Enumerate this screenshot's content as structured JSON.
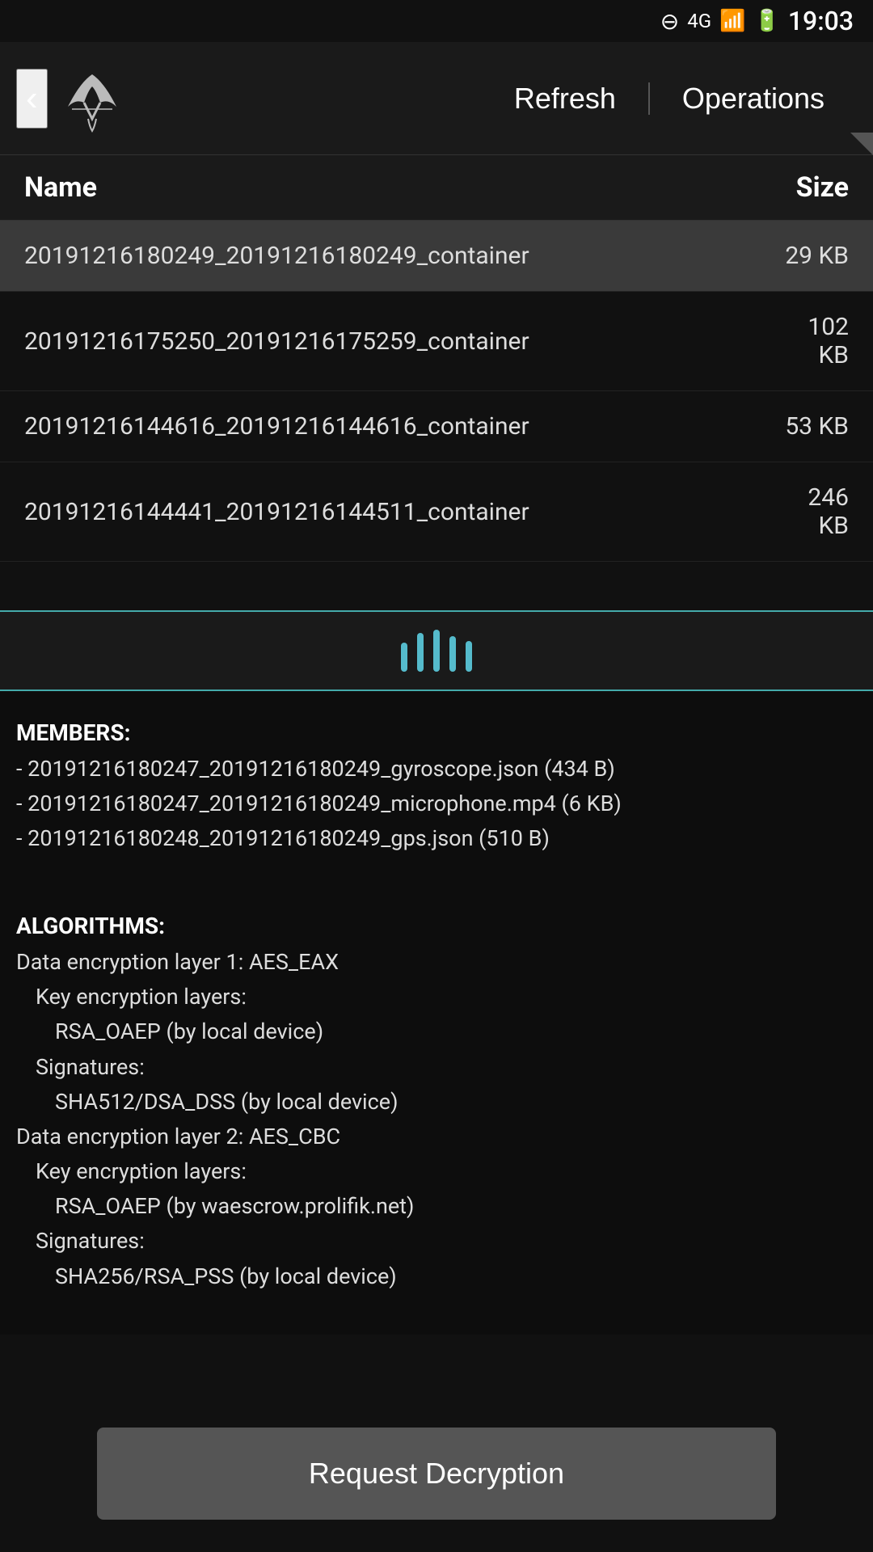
{
  "statusBar": {
    "time": "19:03",
    "icons": [
      "⊖",
      "4G",
      "▲",
      "🔋"
    ]
  },
  "topNav": {
    "backLabel": "‹",
    "refreshLabel": "Refresh",
    "operationsLabel": "Operations"
  },
  "table": {
    "colName": "Name",
    "colSize": "Size"
  },
  "files": [
    {
      "name": "20191216180249_20191216180249_container",
      "size": "29 KB",
      "selected": true
    },
    {
      "name": "20191216175250_20191216175259_container",
      "size": "102\nKB",
      "selected": false
    },
    {
      "name": "20191216144616_20191216144616_container",
      "size": "53 KB",
      "selected": false
    },
    {
      "name": "20191216144441_20191216144511_container",
      "size": "246\nKB",
      "selected": false
    }
  ],
  "dragBars": [
    36,
    48,
    52,
    44,
    38
  ],
  "detail": {
    "membersTitle": "MEMBERS:",
    "members": [
      "- 20191216180247_20191216180249_gyroscope.json (434 B)",
      "- 20191216180247_20191216180249_microphone.mp4 (6 KB)",
      "- 20191216180248_20191216180249_gps.json (510 B)"
    ],
    "algorithmsTitle": "ALGORITHMS:",
    "algorithms": [
      {
        "label": "Data encryption layer 1: AES_EAX",
        "indent": 0
      },
      {
        "label": "Key encryption layers:",
        "indent": 1
      },
      {
        "label": "RSA_OAEP (by local device)",
        "indent": 2
      },
      {
        "label": "Signatures:",
        "indent": 1
      },
      {
        "label": "SHA512/DSA_DSS (by local device)",
        "indent": 2
      },
      {
        "label": "Data encryption layer 2: AES_CBC",
        "indent": 0
      },
      {
        "label": "Key encryption layers:",
        "indent": 1
      },
      {
        "label": "RSA_OAEP (by waescrow.prolifik.net)",
        "indent": 2
      },
      {
        "label": "Signatures:",
        "indent": 1
      },
      {
        "label": "SHA256/RSA_PSS (by local device)",
        "indent": 2
      }
    ]
  },
  "decryptButton": {
    "label": "Request Decryption"
  }
}
